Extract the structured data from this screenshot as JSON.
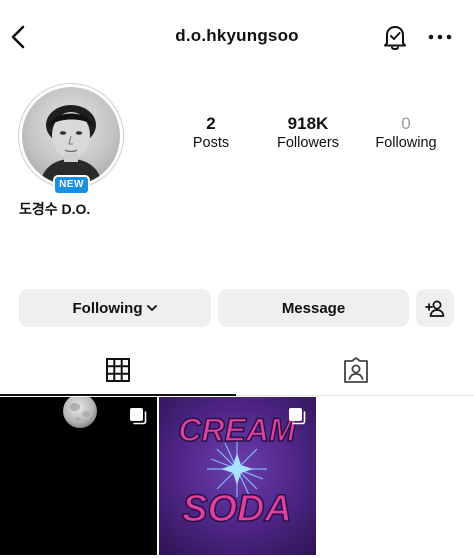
{
  "header": {
    "username": "d.o.hkyungsoo"
  },
  "profile": {
    "badge": "NEW",
    "display_name": "도경수 D.O.",
    "stats": {
      "posts": {
        "value": "2",
        "label": "Posts"
      },
      "followers": {
        "value": "918K",
        "label": "Followers"
      },
      "following": {
        "value": "0",
        "label": "Following"
      }
    }
  },
  "actions": {
    "following_label": "Following",
    "message_label": "Message"
  },
  "tabs": {
    "grid": {
      "icon": "grid-icon",
      "active": true
    },
    "tagged": {
      "icon": "tagged-icon",
      "active": false
    }
  },
  "posts": [
    {
      "name": "moon-photo-post",
      "multiple": true
    },
    {
      "name": "cream-soda-post",
      "text_top": "CREAM",
      "text_bottom": "SODA",
      "multiple": true
    }
  ],
  "colors": {
    "badge_blue": "#1a8fe6",
    "button_gray": "#efefef",
    "cream_soda_purple": "#4b2482",
    "cream_soda_pink": "#e040a0"
  }
}
